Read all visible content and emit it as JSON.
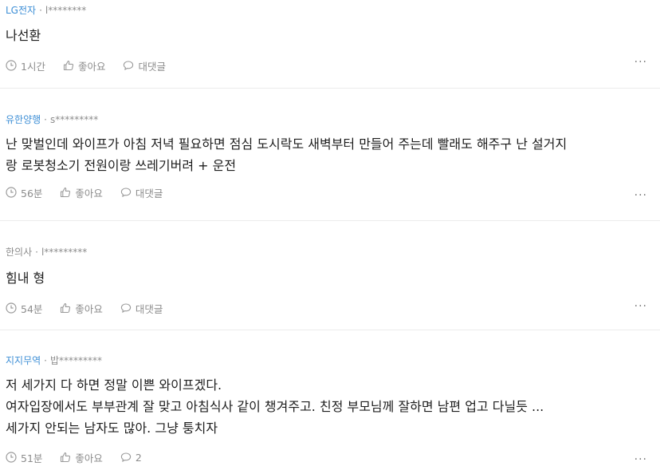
{
  "comments": [
    {
      "company": "LG전자",
      "separator": "·",
      "user": "l********",
      "body": "나선환",
      "time": "1시간",
      "like_label": "좋아요",
      "reply_label": "대댓글",
      "more": "···"
    },
    {
      "company": "유한양행",
      "separator": "·",
      "user": "s*********",
      "body": "난 맞벌인데 와이프가 아침 저녁 필요하면 점심 도시락도 새벽부터 만들어 주는데 빨래도 해주구 난 설거지\n랑 로봇청소기 전원이랑 쓰레기버려 + 운전",
      "time": "56분",
      "like_label": "좋아요",
      "reply_label": "대댓글",
      "more": "···"
    },
    {
      "company": "한의사",
      "separator": "·",
      "user": "l*********",
      "body": "힘내 형",
      "time": "54분",
      "like_label": "좋아요",
      "reply_label": "대댓글",
      "more": "···"
    },
    {
      "company": "지지무역",
      "separator": "·",
      "user": "밥*********",
      "body": "저 세가지 다 하면 정말 이쁜 와이프겠다.\n여자입장에서도 부부관계 잘 맞고 아침식사 같이 챙겨주고. 친정 부모님께 잘하면 남편 업고 다닐듯 ...\n세가지 안되는 남자도 많아. 그냥 퉁치자",
      "time": "51분",
      "like_label": "좋아요",
      "reply_label": "2",
      "more": "···"
    }
  ],
  "colors": {
    "company_accent": "#3e8fd6",
    "meta_gray": "#8c8c8c",
    "body_text": "#1e1e1e"
  },
  "icons": {
    "time": "clock-icon",
    "like": "thumbs-up-icon",
    "reply": "speech-bubble-icon",
    "more": "more-dots-icon"
  }
}
